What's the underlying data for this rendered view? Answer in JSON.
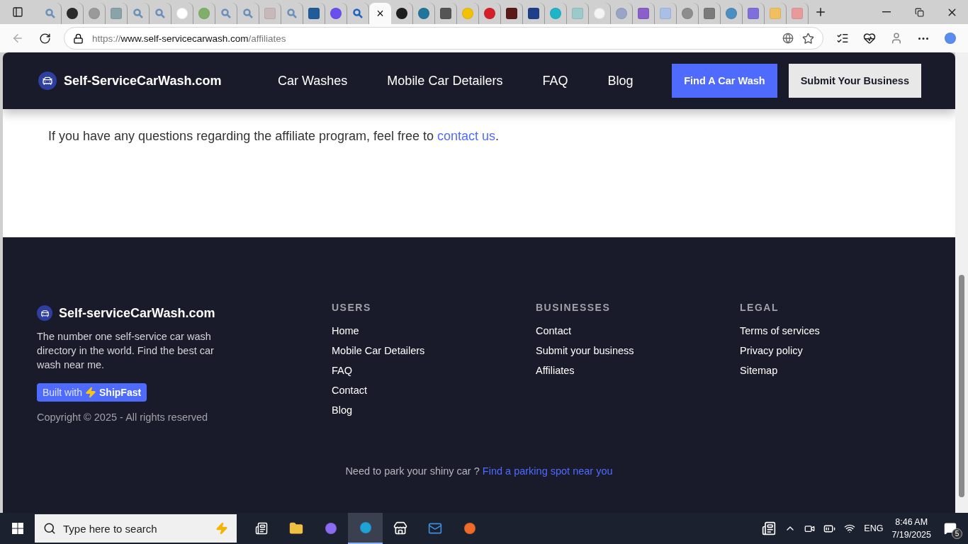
{
  "browser": {
    "tabs": [
      {
        "kind": "search",
        "color": "#6a8fb8",
        "selected": false
      },
      {
        "kind": "round",
        "color": "#2b2b2b",
        "selected": false
      },
      {
        "kind": "round",
        "color": "#9a9a9a",
        "selected": false
      },
      {
        "kind": "square",
        "color": "#8aa3a8",
        "selected": false
      },
      {
        "kind": "search",
        "color": "#6a8fb8",
        "selected": false
      },
      {
        "kind": "search",
        "color": "#6a8fb8",
        "selected": false
      },
      {
        "kind": "round",
        "color": "#ffffff",
        "selected": false
      },
      {
        "kind": "round",
        "color": "#7fb069",
        "selected": false
      },
      {
        "kind": "search",
        "color": "#6a8fb8",
        "selected": false
      },
      {
        "kind": "search",
        "color": "#6a8fb8",
        "selected": false
      },
      {
        "kind": "square",
        "color": "#c9b8b8",
        "selected": false
      },
      {
        "kind": "search",
        "color": "#6a8fb8",
        "selected": false
      },
      {
        "kind": "square",
        "color": "#1f5c99",
        "selected": false
      },
      {
        "kind": "round",
        "color": "#6b4ef0",
        "selected": false
      },
      {
        "kind": "search",
        "color": "#1e63c2",
        "selected": false
      },
      {
        "kind": "close",
        "selected": true,
        "close": "×"
      },
      {
        "kind": "round",
        "color": "#1d1d1d",
        "selected": false
      },
      {
        "kind": "round",
        "color": "#21759b",
        "selected": false
      },
      {
        "kind": "square",
        "color": "#555555",
        "selected": false
      },
      {
        "kind": "round",
        "color": "#f2c200",
        "selected": false
      },
      {
        "kind": "round",
        "color": "#d4202a",
        "selected": false
      },
      {
        "kind": "square",
        "color": "#5a1a1a",
        "selected": false
      },
      {
        "kind": "square",
        "color": "#1f3f8a",
        "selected": false
      },
      {
        "kind": "round",
        "color": "#1fb5c9",
        "selected": false
      },
      {
        "kind": "square",
        "color": "#9cc9c9",
        "selected": false
      },
      {
        "kind": "round",
        "color": "#f4f4f4",
        "selected": false
      },
      {
        "kind": "round",
        "color": "#9aa4c9",
        "selected": false
      },
      {
        "kind": "square",
        "color": "#8a5fc9",
        "selected": false
      },
      {
        "kind": "square",
        "color": "#a9bfe8",
        "selected": false
      },
      {
        "kind": "round",
        "color": "#8d8d8d",
        "selected": false
      },
      {
        "kind": "square",
        "color": "#7a7a7a",
        "selected": false
      },
      {
        "kind": "round",
        "color": "#4a8fc0",
        "selected": false
      },
      {
        "kind": "square",
        "color": "#7e6fdc",
        "selected": false
      },
      {
        "kind": "square",
        "color": "#f0c060",
        "selected": false
      },
      {
        "kind": "square",
        "color": "#e89a9a",
        "selected": false
      }
    ],
    "url": {
      "scheme": "https://",
      "host": "www.self-servicecarwash.com",
      "path": "/affiliates"
    }
  },
  "header": {
    "brand": "Self-ServiceCarWash.com",
    "nav": [
      "Car Washes",
      "Mobile Car Detailers",
      "FAQ",
      "Blog"
    ],
    "buttons": [
      {
        "label": "Find A Car Wash",
        "kind": "primary"
      },
      {
        "label": "Submit Your Business",
        "kind": "secondary"
      }
    ]
  },
  "content": {
    "text": "If you have any questions regarding the affiliate program, feel free to",
    "link": "contact us",
    "end": "."
  },
  "footer": {
    "brand": "Self-serviceCarWash.com",
    "description": "The number one self-service car wash directory in the world. Find the best car wash near me.",
    "badge": {
      "prefix": "Built with",
      "name": "ShipFast"
    },
    "copyright": "Copyright © 2025 - All rights reserved",
    "columns": [
      {
        "title": "USERS",
        "links": [
          "Home",
          "Mobile Car Detailers",
          "FAQ",
          "Contact",
          "Blog"
        ]
      },
      {
        "title": "BUSINESSES",
        "links": [
          "Contact",
          "Submit your business",
          "Affiliates"
        ]
      },
      {
        "title": "LEGAL",
        "links": [
          "Terms of services",
          "Privacy policy",
          "Sitemap"
        ]
      }
    ],
    "note": "Need to park your shiny car ?",
    "note_link": "Find a parking spot near you"
  },
  "taskbar": {
    "search_placeholder": "Type here to search",
    "language": "ENG",
    "time": "8:46 AM",
    "date": "7/19/2025",
    "notifications": "5"
  }
}
